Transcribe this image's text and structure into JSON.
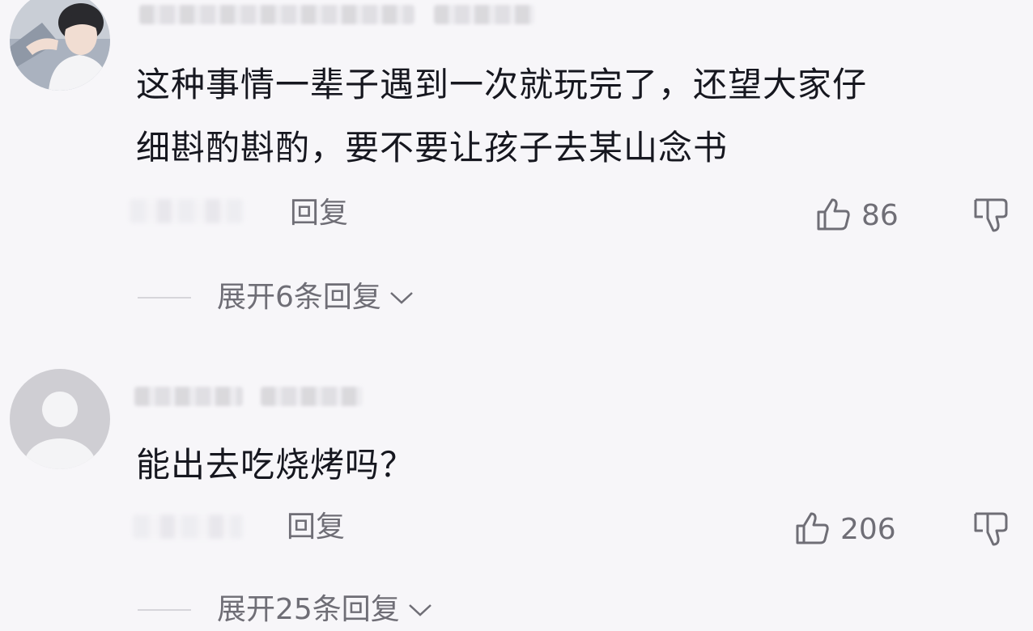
{
  "comments": [
    {
      "text_lines": [
        "这种事情一辈子遇到一次就玩完了，还望大家仔",
        "细斟酌斟酌，要不要让孩子去某山念书"
      ],
      "reply_label": "回复",
      "like_count": "86",
      "expand_label": "展开6条回复"
    },
    {
      "text_lines": [
        "能出去吃烧烤吗？"
      ],
      "reply_label": "回复",
      "like_count": "206",
      "expand_label": "展开25条回复"
    }
  ],
  "icons": {
    "like": "thumbs-up-icon",
    "dislike": "thumbs-down-icon",
    "expand": "chevron-down-icon"
  },
  "colors": {
    "background": "#f7f6f9",
    "text": "#16171f",
    "secondary": "#6f6e76"
  }
}
